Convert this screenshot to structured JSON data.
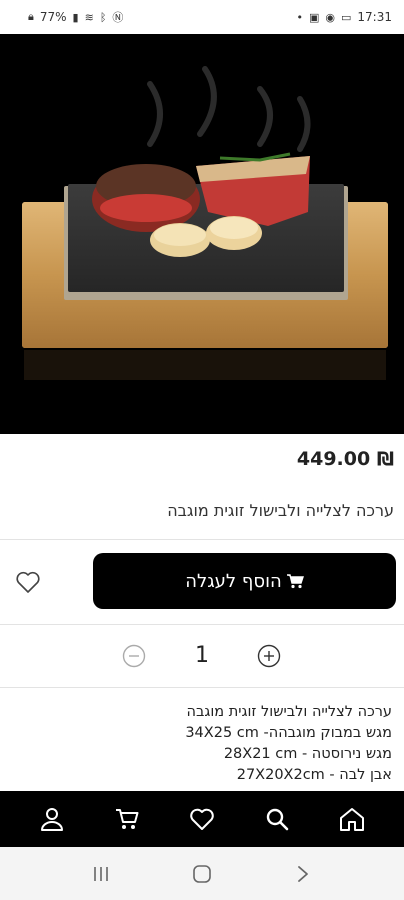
{
  "status_bar": {
    "battery": "77%",
    "time": "17:31"
  },
  "product": {
    "price": "₪ 449.00",
    "title": "ערכה לצלייה ולבישול זוגית מוגבה",
    "image_alt": "steak-on-lava-stone"
  },
  "actions": {
    "add_to_cart_label": "הוסף לעגלה",
    "quantity": "1"
  },
  "description": {
    "lines": [
      "ערכה לצלייה ולבישול זוגית מוגבה",
      "מגש במבוק מוגבהה- 34X25 cm",
      "מגש נירוסטה - 28X21 cm",
      "אבן לבה - 27X20X2cm"
    ]
  },
  "bottom_nav": {
    "items": [
      "account-icon",
      "cart-icon",
      "heart-icon",
      "search-icon",
      "home-icon"
    ]
  },
  "colors": {
    "primary": "#000000",
    "background": "#ffffff"
  }
}
